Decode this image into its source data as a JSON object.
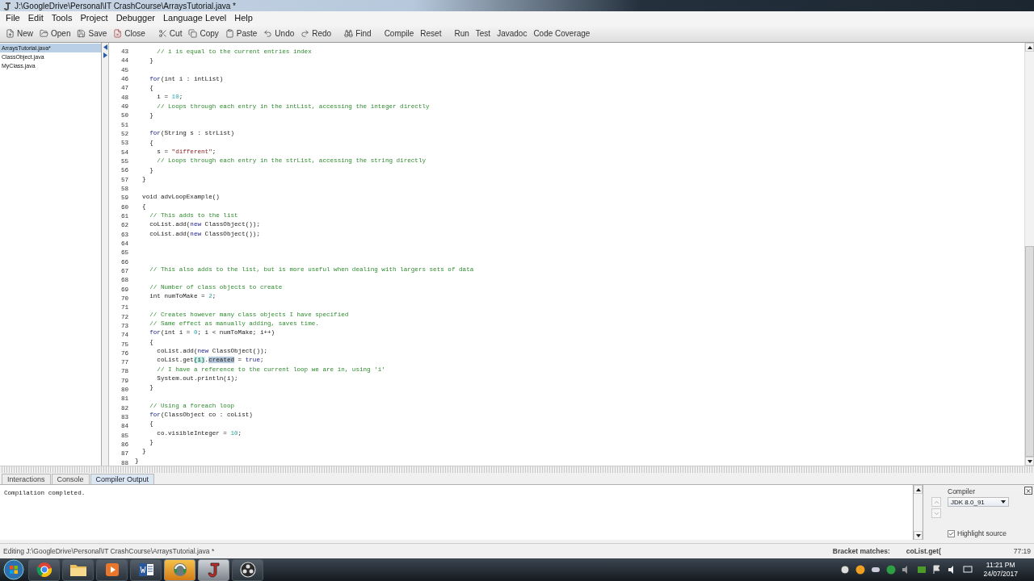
{
  "window": {
    "title": "J:\\GoogleDrive\\Personal\\IT CrashCourse\\ArraysTutorial.java *"
  },
  "menu": [
    "File",
    "Edit",
    "Tools",
    "Project",
    "Debugger",
    "Language Level",
    "Help"
  ],
  "toolbar": [
    {
      "kind": "new",
      "label": "New"
    },
    {
      "kind": "open",
      "label": "Open"
    },
    {
      "kind": "save",
      "label": "Save"
    },
    {
      "kind": "close",
      "label": "Close"
    },
    {
      "kind": "separator"
    },
    {
      "kind": "cut",
      "label": "Cut"
    },
    {
      "kind": "copy",
      "label": "Copy"
    },
    {
      "kind": "paste",
      "label": "Paste"
    },
    {
      "kind": "undo",
      "label": "Undo"
    },
    {
      "kind": "redo",
      "label": "Redo"
    },
    {
      "kind": "separator"
    },
    {
      "kind": "find",
      "label": "Find"
    },
    {
      "kind": "separator"
    },
    {
      "kind": "text",
      "label": "Compile"
    },
    {
      "kind": "text",
      "label": "Reset"
    },
    {
      "kind": "separator"
    },
    {
      "kind": "text",
      "label": "Run"
    },
    {
      "kind": "text",
      "label": "Test"
    },
    {
      "kind": "text",
      "label": "Javadoc"
    },
    {
      "kind": "text",
      "label": "Code Coverage"
    }
  ],
  "files": [
    {
      "name": "ArraysTutorial.java*",
      "selected": true
    },
    {
      "name": "ClassObject.java",
      "selected": false
    },
    {
      "name": "MyClass.java",
      "selected": false
    }
  ],
  "editor": {
    "lines": [
      {
        "number": "43",
        "segments": [
          {
            "kind": "comment",
            "text": "      // i is equal to the current entries index"
          }
        ]
      },
      {
        "number": "44",
        "segments": [
          {
            "kind": "plain",
            "text": "    }"
          }
        ]
      },
      {
        "number": "45"
      },
      {
        "number": "46",
        "segments": [
          {
            "kind": "keyword",
            "text": "    for"
          },
          {
            "kind": "plain",
            "text": "(int i : intList)"
          }
        ]
      },
      {
        "number": "47",
        "segments": [
          {
            "kind": "plain",
            "text": "    {"
          }
        ]
      },
      {
        "number": "48",
        "segments": [
          {
            "kind": "plain",
            "text": "      i = "
          },
          {
            "kind": "number",
            "text": "10"
          },
          {
            "kind": "plain",
            "text": ";"
          }
        ]
      },
      {
        "number": "49",
        "segments": [
          {
            "kind": "comment",
            "text": "      // Loops through each entry in the intList, accessing the integer directly"
          }
        ]
      },
      {
        "number": "50",
        "segments": [
          {
            "kind": "plain",
            "text": "    }"
          }
        ]
      },
      {
        "number": "51"
      },
      {
        "number": "52",
        "segments": [
          {
            "kind": "keyword",
            "text": "    for"
          },
          {
            "kind": "plain",
            "text": "(String s : strList)"
          }
        ]
      },
      {
        "number": "53",
        "segments": [
          {
            "kind": "plain",
            "text": "    {"
          }
        ]
      },
      {
        "number": "54",
        "segments": [
          {
            "kind": "plain",
            "text": "      s = "
          },
          {
            "kind": "string",
            "text": "\"different\""
          },
          {
            "kind": "plain",
            "text": ";"
          }
        ]
      },
      {
        "number": "55",
        "segments": [
          {
            "kind": "comment",
            "text": "      // Loops through each entry in the strList, accessing the string directly"
          }
        ]
      },
      {
        "number": "56",
        "segments": [
          {
            "kind": "plain",
            "text": "    }"
          }
        ]
      },
      {
        "number": "57",
        "segments": [
          {
            "kind": "plain",
            "text": "  }"
          }
        ]
      },
      {
        "number": "58"
      },
      {
        "number": "59",
        "segments": [
          {
            "kind": "plain",
            "text": "  void advLoopExample()"
          }
        ]
      },
      {
        "number": "60",
        "segments": [
          {
            "kind": "plain",
            "text": "  {"
          }
        ]
      },
      {
        "number": "61",
        "segments": [
          {
            "kind": "comment",
            "text": "    // This adds to the list"
          }
        ]
      },
      {
        "number": "62",
        "segments": [
          {
            "kind": "plain",
            "text": "    coList.add("
          },
          {
            "kind": "keyword",
            "text": "new"
          },
          {
            "kind": "plain",
            "text": " ClassObject());"
          }
        ]
      },
      {
        "number": "63",
        "segments": [
          {
            "kind": "plain",
            "text": "    coList.add("
          },
          {
            "kind": "keyword",
            "text": "new"
          },
          {
            "kind": "plain",
            "text": " ClassObject());"
          }
        ]
      },
      {
        "number": "64"
      },
      {
        "number": "65"
      },
      {
        "number": "66"
      },
      {
        "number": "67",
        "segments": [
          {
            "kind": "comment",
            "text": "    // This also adds to the list, but is more useful when dealing with largers sets of data"
          }
        ]
      },
      {
        "number": "68"
      },
      {
        "number": "69",
        "segments": [
          {
            "kind": "comment",
            "text": "    // Number of class objects to create"
          }
        ]
      },
      {
        "number": "70",
        "segments": [
          {
            "kind": "plain",
            "text": "    int numToMake = "
          },
          {
            "kind": "number",
            "text": "2"
          },
          {
            "kind": "plain",
            "text": ";"
          }
        ]
      },
      {
        "number": "71"
      },
      {
        "number": "72",
        "segments": [
          {
            "kind": "comment",
            "text": "    // Creates however many class objects I have specified"
          }
        ]
      },
      {
        "number": "73",
        "segments": [
          {
            "kind": "comment",
            "text": "    // Same effect as manually adding, saves time."
          }
        ]
      },
      {
        "number": "74",
        "segments": [
          {
            "kind": "keyword",
            "text": "    for"
          },
          {
            "kind": "plain",
            "text": "(int i = "
          },
          {
            "kind": "number",
            "text": "0"
          },
          {
            "kind": "plain",
            "text": "; i < numToMake; i++)"
          }
        ]
      },
      {
        "number": "75",
        "segments": [
          {
            "kind": "plain",
            "text": "    {"
          }
        ]
      },
      {
        "number": "76",
        "segments": [
          {
            "kind": "plain",
            "text": "      coList.add("
          },
          {
            "kind": "keyword",
            "text": "new"
          },
          {
            "kind": "plain",
            "text": " ClassObject());"
          }
        ]
      },
      {
        "number": "77",
        "segments": [
          {
            "kind": "plain",
            "text": "      coList.get"
          },
          {
            "kind": "match",
            "text": "(i)"
          },
          {
            "kind": "plain",
            "text": "."
          },
          {
            "kind": "selection",
            "text": "created"
          },
          {
            "kind": "plain",
            "text": " = "
          },
          {
            "kind": "keyword",
            "text": "true"
          },
          {
            "kind": "plain",
            "text": ";"
          }
        ]
      },
      {
        "number": "78",
        "segments": [
          {
            "kind": "comment",
            "text": "      // I have a reference to the current loop we are in, using 'i'"
          }
        ]
      },
      {
        "number": "79",
        "segments": [
          {
            "kind": "plain",
            "text": "      System.out.println(i);"
          }
        ]
      },
      {
        "number": "80",
        "segments": [
          {
            "kind": "plain",
            "text": "    }"
          }
        ]
      },
      {
        "number": "81"
      },
      {
        "number": "82",
        "segments": [
          {
            "kind": "comment",
            "text": "    // Using a foreach loop"
          }
        ]
      },
      {
        "number": "83",
        "segments": [
          {
            "kind": "keyword",
            "text": "    for"
          },
          {
            "kind": "plain",
            "text": "(ClassObject co : coList)"
          }
        ]
      },
      {
        "number": "84",
        "segments": [
          {
            "kind": "plain",
            "text": "    {"
          }
        ]
      },
      {
        "number": "85",
        "segments": [
          {
            "kind": "plain",
            "text": "      co.visibleInteger = "
          },
          {
            "kind": "number",
            "text": "10"
          },
          {
            "kind": "plain",
            "text": ";"
          }
        ]
      },
      {
        "number": "86",
        "segments": [
          {
            "kind": "plain",
            "text": "    }"
          }
        ]
      },
      {
        "number": "87",
        "segments": [
          {
            "kind": "plain",
            "text": "  }"
          }
        ]
      },
      {
        "number": "88",
        "segments": [
          {
            "kind": "plain",
            "text": "}"
          }
        ]
      }
    ]
  },
  "bottom_tabs": [
    {
      "label": "Interactions",
      "selected": false
    },
    {
      "label": "Console",
      "selected": false
    },
    {
      "label": "Compiler Output",
      "selected": true
    }
  ],
  "output": {
    "text": "Compilation completed."
  },
  "compiler": {
    "label": "Compiler",
    "value": "JDK 8.0_91",
    "highlight_label": "Highlight source",
    "highlight_checked": true
  },
  "status_bar": {
    "message": "Editing J:\\GoogleDrive\\Personal\\IT CrashCourse\\ArraysTutorial.java *",
    "bracket_label": "Bracket matches:",
    "bracket_value": "coList.get(",
    "position": "77:19"
  },
  "taskbar": {
    "apps": [
      {
        "kind": "browser",
        "active": false
      },
      {
        "kind": "folder",
        "active": false
      },
      {
        "kind": "media",
        "active": false
      },
      {
        "kind": "word",
        "active": false
      },
      {
        "kind": "voice",
        "active": true
      },
      {
        "kind": "java",
        "active": true
      },
      {
        "kind": "recorder",
        "active": false
      }
    ],
    "time": "11:21 PM",
    "date": "24/07/2017"
  }
}
